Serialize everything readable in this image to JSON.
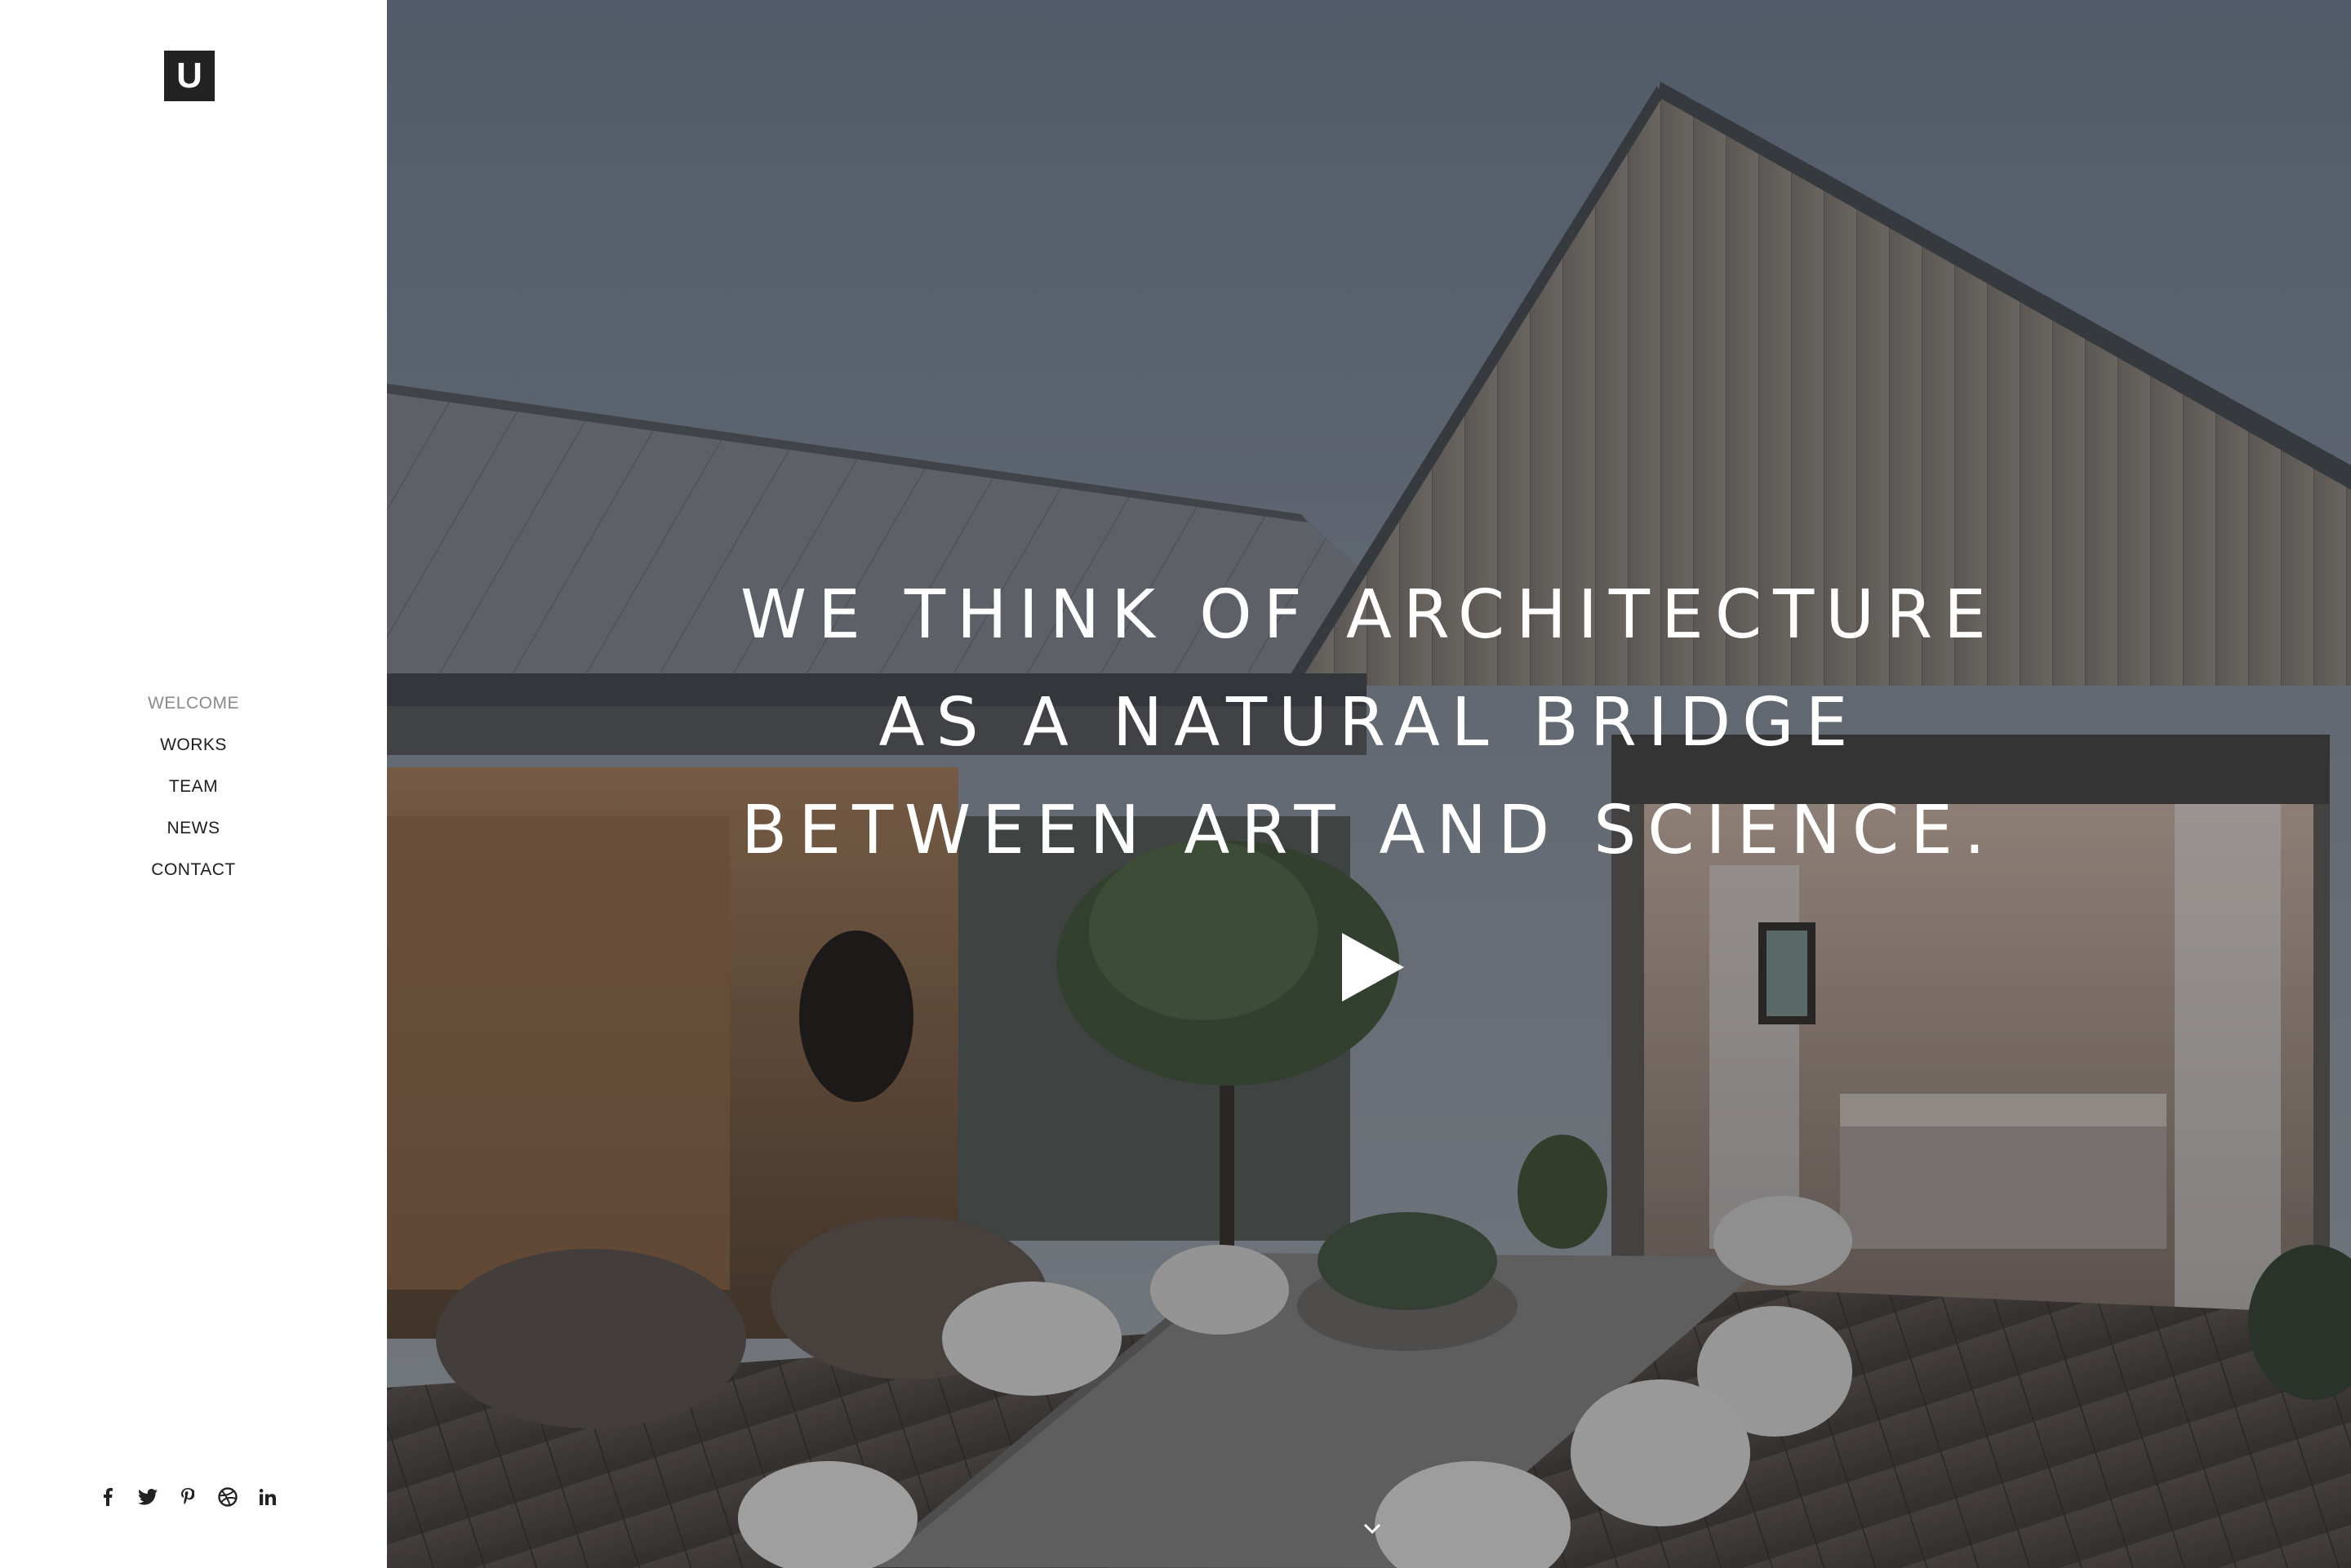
{
  "logo": {
    "text": "U"
  },
  "nav": {
    "items": [
      {
        "label": "WELCOME",
        "active": true
      },
      {
        "label": "WORKS",
        "active": false
      },
      {
        "label": "TEAM",
        "active": false
      },
      {
        "label": "NEWS",
        "active": false
      },
      {
        "label": "CONTACT",
        "active": false
      }
    ]
  },
  "social": {
    "icons": [
      "facebook-icon",
      "twitter-icon",
      "pinterest-icon",
      "dribbble-icon",
      "linkedin-icon"
    ]
  },
  "hero": {
    "headline_lines": [
      "WE THINK OF ARCHITECTURE",
      "AS A NATURAL BRIDGE",
      "BETWEEN ART AND SCIENCE."
    ],
    "play_icon": "play-icon",
    "scroll_icon": "chevron-down-icon"
  },
  "colors": {
    "logo_bg": "#222222",
    "nav_text": "#1e1e1e",
    "nav_active": "#8a8a8a",
    "headline": "#ffffff"
  }
}
